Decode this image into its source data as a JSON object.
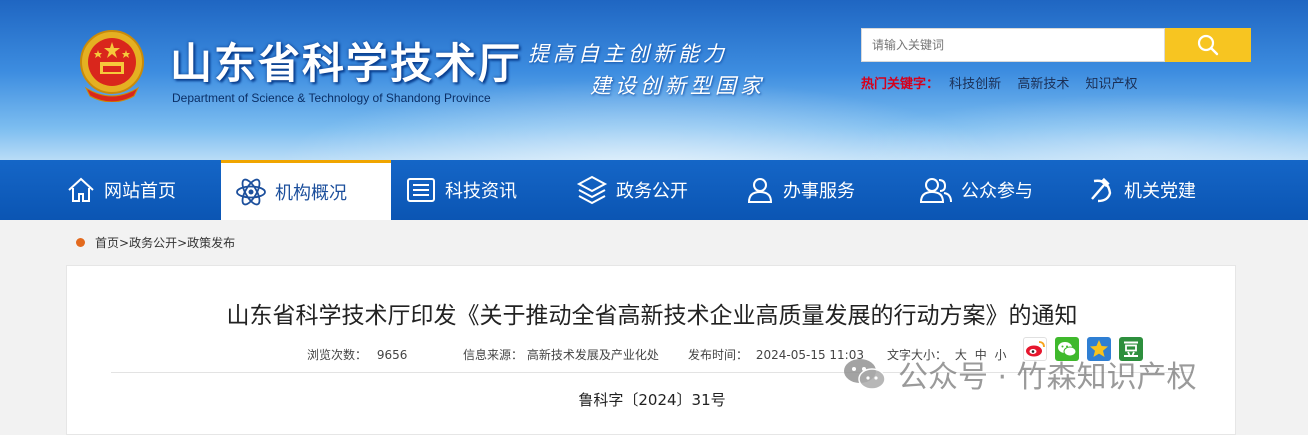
{
  "header": {
    "title": "山东省科学技术厅",
    "subtitle": "Department of Science & Technology of Shandong Province",
    "slogan_line1": "提高自主创新能力",
    "slogan_line2": "建设创新型国家"
  },
  "search": {
    "placeholder": "请输入关键词",
    "hot_label": "热门关键字：",
    "hot_keywords": [
      "科技创新",
      "高新技术",
      "知识产权"
    ]
  },
  "nav": {
    "items": [
      {
        "label": "网站首页",
        "icon": "home-icon"
      },
      {
        "label": "机构概况",
        "icon": "atom-icon",
        "active": true
      },
      {
        "label": "科技资讯",
        "icon": "news-icon"
      },
      {
        "label": "政务公开",
        "icon": "layers-icon"
      },
      {
        "label": "办事服务",
        "icon": "user-icon"
      },
      {
        "label": "公众参与",
        "icon": "users-icon"
      },
      {
        "label": "机关党建",
        "icon": "hammer-sickle-icon"
      }
    ]
  },
  "breadcrumb": {
    "items": [
      "首页",
      "政务公开",
      "政策发布"
    ],
    "separator": ">"
  },
  "article": {
    "title": "山东省科学技术厅印发《关于推动全省高新技术企业高质量发展的行动方案》的通知",
    "views_label": "浏览次数：",
    "views": "9656",
    "source_label": "信息来源：",
    "source": "高新技术发展及产业化处",
    "date_label": "发布时间：",
    "date": "2024-05-15 11:03",
    "font_size_label": "文字大小：",
    "font_sizes": [
      "大",
      "中",
      "小"
    ],
    "share_icons": [
      "weibo-icon",
      "wechat-icon",
      "qzone-icon",
      "douban-icon"
    ],
    "doc_number": "鲁科字〔2024〕31号"
  },
  "watermark": {
    "text": "公众号 · 竹森知识产权"
  },
  "colors": {
    "nav_bg": "#0b55b3",
    "search_button": "#f7c521",
    "hot_label": "#d6001c",
    "breadcrumb_dot": "#e36a1e"
  }
}
